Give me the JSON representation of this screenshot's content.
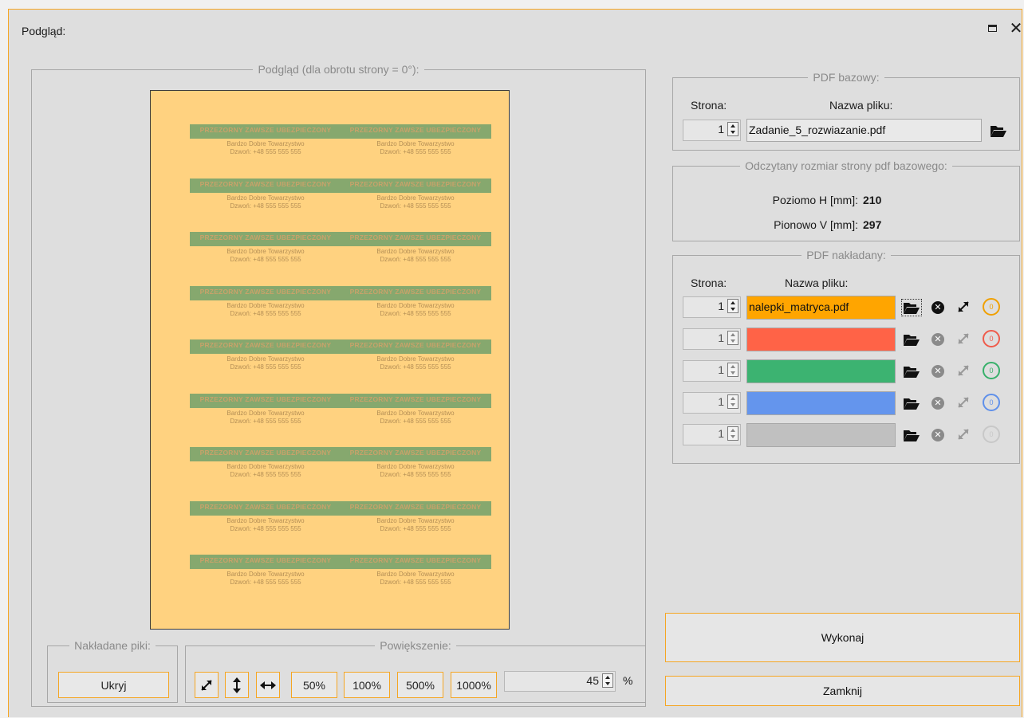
{
  "window": {
    "title": "Podgląd:",
    "close_glyph": "✕"
  },
  "preview": {
    "legend": "Podgląd (dla obrotu strony = 0°):",
    "label_title": "PRZEZORNY ZAWSZE UBEZPIECZONY",
    "label_line1": "Bardzo Dobre Towarzystwo",
    "label_line2": "Dzwoń: +48 555 555 555",
    "page_color": "#ffd280",
    "band_color": "#86a86e"
  },
  "piki": {
    "legend": "Nakładane piki:",
    "hide_label": "Ukryj"
  },
  "zoom": {
    "legend": "Powiększenie:",
    "fit_icons": [
      "expand-icon",
      "fit-height-icon",
      "fit-width-icon"
    ],
    "presets": [
      "50%",
      "100%",
      "500%",
      "1000%"
    ],
    "value": "45",
    "unit": "%"
  },
  "base_pdf": {
    "legend": "PDF bazowy:",
    "page_label": "Strona:",
    "name_label": "Nazwa pliku:",
    "page_value": "1",
    "file_name": "Zadanie_5_rozwiazanie.pdf"
  },
  "page_size": {
    "legend": "Odczytany rozmiar strony pdf bazowego:",
    "h_label": "Poziomo H [mm]:",
    "h_value": "210",
    "v_label": "Pionowo V [mm]:",
    "v_value": "297"
  },
  "overlay_pdf": {
    "legend": "PDF nakładany:",
    "page_label": "Strona:",
    "name_label": "Nazwa pliku:",
    "rows": [
      {
        "page": "1",
        "file": "nalepki_matryca.pdf",
        "color": "#ffa500",
        "ring_color": "#f0a000",
        "count": "0",
        "active": true
      },
      {
        "page": "1",
        "file": "",
        "color": "#ff6347",
        "ring_color": "#ef5b4b",
        "count": "0",
        "active": false
      },
      {
        "page": "1",
        "file": "",
        "color": "#3cb371",
        "ring_color": "#37b06a",
        "count": "0",
        "active": false
      },
      {
        "page": "1",
        "file": "",
        "color": "#6495ed",
        "ring_color": "#5f90ea",
        "count": "0",
        "active": false
      },
      {
        "page": "1",
        "file": "",
        "color": "#c0c0c0",
        "ring_color": "#c8c8c8",
        "count": "0",
        "active": false
      }
    ]
  },
  "actions": {
    "execute": "Wykonaj",
    "close": "Zamknij"
  }
}
